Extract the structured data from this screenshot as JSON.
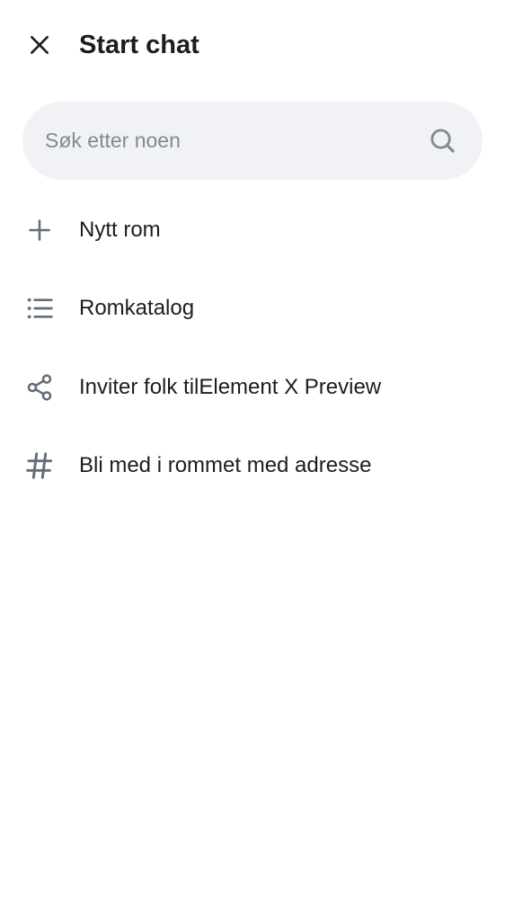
{
  "header": {
    "title": "Start chat",
    "close_icon": "close-icon"
  },
  "search": {
    "placeholder": "Søk etter noen",
    "value": "",
    "icon": "search-icon"
  },
  "menu": {
    "items": [
      {
        "label": "Nytt rom",
        "icon": "plus-icon"
      },
      {
        "label": "Romkatalog",
        "icon": "list-icon"
      },
      {
        "label": "Inviter folk tilElement X Preview",
        "icon": "share-icon"
      },
      {
        "label": "Bli med i rommet med adresse",
        "icon": "hash-icon"
      }
    ]
  },
  "colors": {
    "text": "#1b1d22",
    "icon": "#656d77",
    "search_bg": "#f0f2f5",
    "placeholder": "#818a95"
  }
}
